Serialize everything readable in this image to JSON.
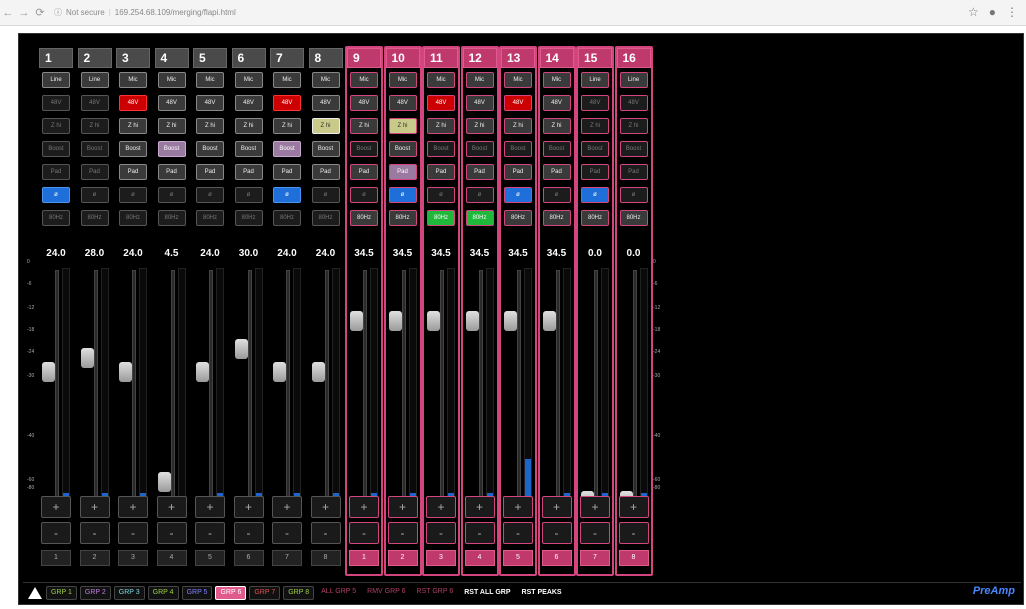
{
  "browser": {
    "security": "Not secure",
    "url": "169.254.68.109/merging/flapi.html"
  },
  "channels": [
    {
      "num": "1",
      "type": "Line",
      "p48": "48V",
      "p48_state": "off",
      "z": "Z hi",
      "z_state": "off",
      "boost": "Boost",
      "boost_state": "off",
      "pad": "Pad",
      "pad_state": "off",
      "phase": "ø",
      "phase_state": "blue",
      "hpf": "80Hz",
      "hpf_state": "off",
      "gain": "24.0",
      "fader": 0.6,
      "meter": 0.08,
      "bottom": "1",
      "group": "grey"
    },
    {
      "num": "2",
      "type": "Line",
      "p48": "48V",
      "p48_state": "off",
      "z": "Z hi",
      "z_state": "off",
      "boost": "Boost",
      "boost_state": "off",
      "pad": "Pad",
      "pad_state": "off",
      "phase": "ø",
      "phase_state": "off",
      "hpf": "80Hz",
      "hpf_state": "off",
      "gain": "28.0",
      "fader": 0.66,
      "meter": 0.08,
      "bottom": "2",
      "group": "grey"
    },
    {
      "num": "3",
      "type": "Mic",
      "p48": "48V",
      "p48_state": "red",
      "z": "Z hi",
      "z_state": "on",
      "boost": "Boost",
      "boost_state": "on",
      "pad": "Pad",
      "pad_state": "on",
      "phase": "ø",
      "phase_state": "off",
      "hpf": "80Hz",
      "hpf_state": "off",
      "gain": "24.0",
      "fader": 0.6,
      "meter": 0.08,
      "bottom": "3",
      "group": "grey"
    },
    {
      "num": "4",
      "type": "Mic",
      "p48": "48V",
      "p48_state": "on",
      "z": "Z hi",
      "z_state": "on",
      "boost": "Boost",
      "boost_state": "purple",
      "pad": "Pad",
      "pad_state": "on",
      "phase": "ø",
      "phase_state": "off",
      "hpf": "80Hz",
      "hpf_state": "off",
      "gain": "4.5",
      "fader": 0.12,
      "meter": 0.04,
      "bottom": "4",
      "group": "grey"
    },
    {
      "num": "5",
      "type": "Mic",
      "p48": "48V",
      "p48_state": "on",
      "z": "Z hi",
      "z_state": "on",
      "boost": "Boost",
      "boost_state": "on",
      "pad": "Pad",
      "pad_state": "on",
      "phase": "ø",
      "phase_state": "off",
      "hpf": "80Hz",
      "hpf_state": "off",
      "gain": "24.0",
      "fader": 0.6,
      "meter": 0.08,
      "bottom": "5",
      "group": "grey"
    },
    {
      "num": "6",
      "type": "Mic",
      "p48": "48V",
      "p48_state": "on",
      "z": "Z hi",
      "z_state": "on",
      "boost": "Boost",
      "boost_state": "on",
      "pad": "Pad",
      "pad_state": "on",
      "phase": "ø",
      "phase_state": "off",
      "hpf": "80Hz",
      "hpf_state": "off",
      "gain": "30.0",
      "fader": 0.7,
      "meter": 0.08,
      "bottom": "6",
      "group": "grey"
    },
    {
      "num": "7",
      "type": "Mic",
      "p48": "48V",
      "p48_state": "red",
      "z": "Z hi",
      "z_state": "on",
      "boost": "Boost",
      "boost_state": "purple",
      "pad": "Pad",
      "pad_state": "on",
      "phase": "ø",
      "phase_state": "blue",
      "hpf": "80Hz",
      "hpf_state": "off",
      "gain": "24.0",
      "fader": 0.6,
      "meter": 0.08,
      "bottom": "7",
      "group": "grey"
    },
    {
      "num": "8",
      "type": "Mic",
      "p48": "48V",
      "p48_state": "on",
      "z": "Z hi",
      "z_state": "yellow",
      "boost": "Boost",
      "boost_state": "on",
      "pad": "Pad",
      "pad_state": "on",
      "phase": "ø",
      "phase_state": "off",
      "hpf": "80Hz",
      "hpf_state": "off",
      "gain": "24.0",
      "fader": 0.6,
      "meter": 0.08,
      "bottom": "8",
      "group": "grey"
    },
    {
      "num": "9",
      "type": "Mic",
      "p48": "48V",
      "p48_state": "on",
      "z": "Z hi",
      "z_state": "on",
      "boost": "Boost",
      "boost_state": "off",
      "pad": "Pad",
      "pad_state": "on",
      "phase": "ø",
      "phase_state": "off",
      "hpf": "80Hz",
      "hpf_state": "on",
      "gain": "34.5",
      "fader": 0.82,
      "meter": 0.08,
      "bottom": "1",
      "group": "pink"
    },
    {
      "num": "10",
      "type": "Mic",
      "p48": "48V",
      "p48_state": "on",
      "z": "Z hi",
      "z_state": "yellow",
      "boost": "Boost",
      "boost_state": "on",
      "pad": "Pad",
      "pad_state": "purple",
      "phase": "ø",
      "phase_state": "blue",
      "hpf": "80Hz",
      "hpf_state": "on",
      "gain": "34.5",
      "fader": 0.82,
      "meter": 0.08,
      "bottom": "2",
      "group": "pink"
    },
    {
      "num": "11",
      "type": "Mic",
      "p48": "48V",
      "p48_state": "red",
      "z": "Z hi",
      "z_state": "on",
      "boost": "Boost",
      "boost_state": "off",
      "pad": "Pad",
      "pad_state": "on",
      "phase": "ø",
      "phase_state": "off",
      "hpf": "80Hz",
      "hpf_state": "green",
      "gain": "34.5",
      "fader": 0.82,
      "meter": 0.08,
      "bottom": "3",
      "group": "pink"
    },
    {
      "num": "12",
      "type": "Mic",
      "p48": "48V",
      "p48_state": "on",
      "z": "Z hi",
      "z_state": "on",
      "boost": "Boost",
      "boost_state": "off",
      "pad": "Pad",
      "pad_state": "on",
      "phase": "ø",
      "phase_state": "off",
      "hpf": "80Hz",
      "hpf_state": "green",
      "gain": "34.5",
      "fader": 0.82,
      "meter": 0.08,
      "bottom": "4",
      "group": "pink"
    },
    {
      "num": "13",
      "type": "Mic",
      "p48": "48V",
      "p48_state": "red",
      "z": "Z hi",
      "z_state": "on",
      "boost": "Boost",
      "boost_state": "off",
      "pad": "Pad",
      "pad_state": "on",
      "phase": "ø",
      "phase_state": "blue",
      "hpf": "80Hz",
      "hpf_state": "on",
      "gain": "34.5",
      "fader": 0.82,
      "meter": 0.22,
      "bottom": "5",
      "group": "pink"
    },
    {
      "num": "14",
      "type": "Mic",
      "p48": "48V",
      "p48_state": "on",
      "z": "Z hi",
      "z_state": "on",
      "boost": "Boost",
      "boost_state": "off",
      "pad": "Pad",
      "pad_state": "on",
      "phase": "ø",
      "phase_state": "off",
      "hpf": "80Hz",
      "hpf_state": "on",
      "gain": "34.5",
      "fader": 0.82,
      "meter": 0.08,
      "bottom": "6",
      "group": "pink"
    },
    {
      "num": "15",
      "type": "Line",
      "p48": "48V",
      "p48_state": "off",
      "z": "Z hi",
      "z_state": "off",
      "boost": "Boost",
      "boost_state": "off",
      "pad": "Pad",
      "pad_state": "off",
      "phase": "ø",
      "phase_state": "blue",
      "hpf": "80Hz",
      "hpf_state": "on",
      "gain": "0.0",
      "fader": 0.04,
      "meter": 0.08,
      "bottom": "7",
      "group": "pink"
    },
    {
      "num": "16",
      "type": "Line",
      "p48": "48V",
      "p48_state": "off",
      "z": "Z hi",
      "z_state": "off",
      "boost": "Boost",
      "boost_state": "off",
      "pad": "Pad",
      "pad_state": "off",
      "phase": "ø",
      "phase_state": "off",
      "hpf": "80Hz",
      "hpf_state": "on",
      "gain": "0.0",
      "fader": 0.04,
      "meter": 0.08,
      "bottom": "8",
      "group": "pink"
    }
  ],
  "scale_left": [
    "0",
    "-6",
    "-12",
    "-18",
    "-24",
    "-30",
    "-40",
    "-60",
    "-80"
  ],
  "scale_right": [
    "0",
    "-6",
    "-12",
    "-18",
    "-24",
    "-30",
    "-40",
    "-60",
    "-80"
  ],
  "bottom": {
    "groups": [
      {
        "label": "GRP 1",
        "color": "#9fcf4a",
        "active": false
      },
      {
        "label": "GRP 2",
        "color": "#c080e0",
        "active": false
      },
      {
        "label": "GRP 3",
        "color": "#7fd7e0",
        "active": false
      },
      {
        "label": "GRP 4",
        "color": "#9fcf4a",
        "active": false
      },
      {
        "label": "GRP 5",
        "color": "#7f80ff",
        "active": false
      },
      {
        "label": "GRP 6",
        "color": "#ffffff",
        "active": true
      },
      {
        "label": "GRP 7",
        "color": "#e05050",
        "active": false
      },
      {
        "label": "GRP 8",
        "color": "#9fcf4a",
        "active": false
      }
    ],
    "dim_buttons": [
      {
        "label": "ALL GRP 5",
        "color": "#b0406a"
      },
      {
        "label": "RMV GRP 6",
        "color": "#b0406a"
      },
      {
        "label": "RST GRP 6",
        "color": "#b0406a"
      }
    ],
    "rst_all": "RST ALL GRP",
    "rst_peaks": "RST PEAKS",
    "brand": "PreAmp"
  }
}
